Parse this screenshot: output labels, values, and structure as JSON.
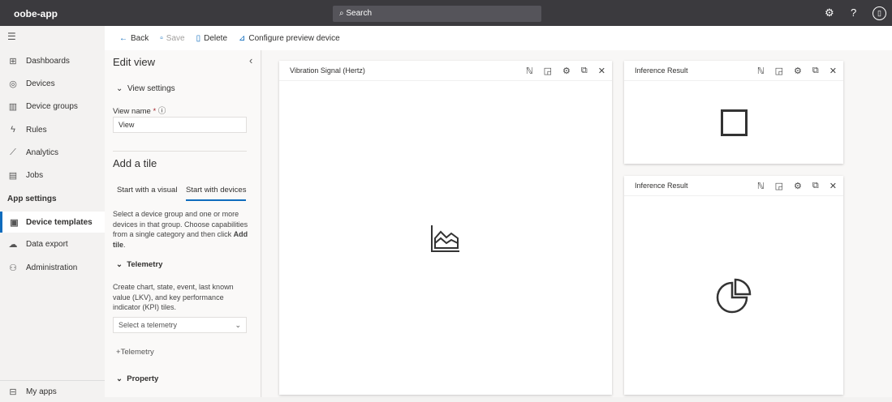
{
  "app_title": "oobe-app",
  "search": {
    "placeholder": "Search"
  },
  "topbar_icons": [
    "gear-icon",
    "help-icon",
    "account-icon"
  ],
  "nav": {
    "items": [
      {
        "label": "Dashboards",
        "icon": "dashboard-icon"
      },
      {
        "label": "Devices",
        "icon": "devices-icon"
      },
      {
        "label": "Device groups",
        "icon": "device-groups-icon"
      },
      {
        "label": "Rules",
        "icon": "rules-icon"
      },
      {
        "label": "Analytics",
        "icon": "analytics-icon"
      },
      {
        "label": "Jobs",
        "icon": "jobs-icon"
      }
    ],
    "section": "App settings",
    "settings": [
      {
        "label": "Device templates",
        "selected": true
      },
      {
        "label": "Data export"
      },
      {
        "label": "Administration"
      }
    ],
    "bottom": "My apps"
  },
  "commands": {
    "back": "Back",
    "save": "Save",
    "delete": "Delete",
    "configure": "Configure preview device"
  },
  "panel": {
    "title": "Edit view",
    "view_settings": "View settings",
    "view_name_label": "View name",
    "required": "*",
    "view_name_value": "View",
    "add_tile": "Add a tile",
    "tabs": [
      "Start with a visual",
      "Start with devices"
    ],
    "desc": "Select a device group and one or more devices in that group. Choose capabilities from a single category and then click ",
    "desc_bold": "Add tile",
    "desc_end": ".",
    "telemetry": "Telemetry",
    "telemetry_desc": "Create chart, state, event, last known value (LKV), and key performance indicator (KPI) tiles.",
    "select_placeholder": "Select a telemetry",
    "add_telemetry": "Telemetry",
    "property": "Property"
  },
  "tiles": [
    {
      "title": "Vibration Signal (Hertz)",
      "icon": "area-chart-icon"
    },
    {
      "title": "Inference Result",
      "icon": "square-icon"
    },
    {
      "title": "Inference Result",
      "icon": "pie-chart-icon"
    }
  ]
}
